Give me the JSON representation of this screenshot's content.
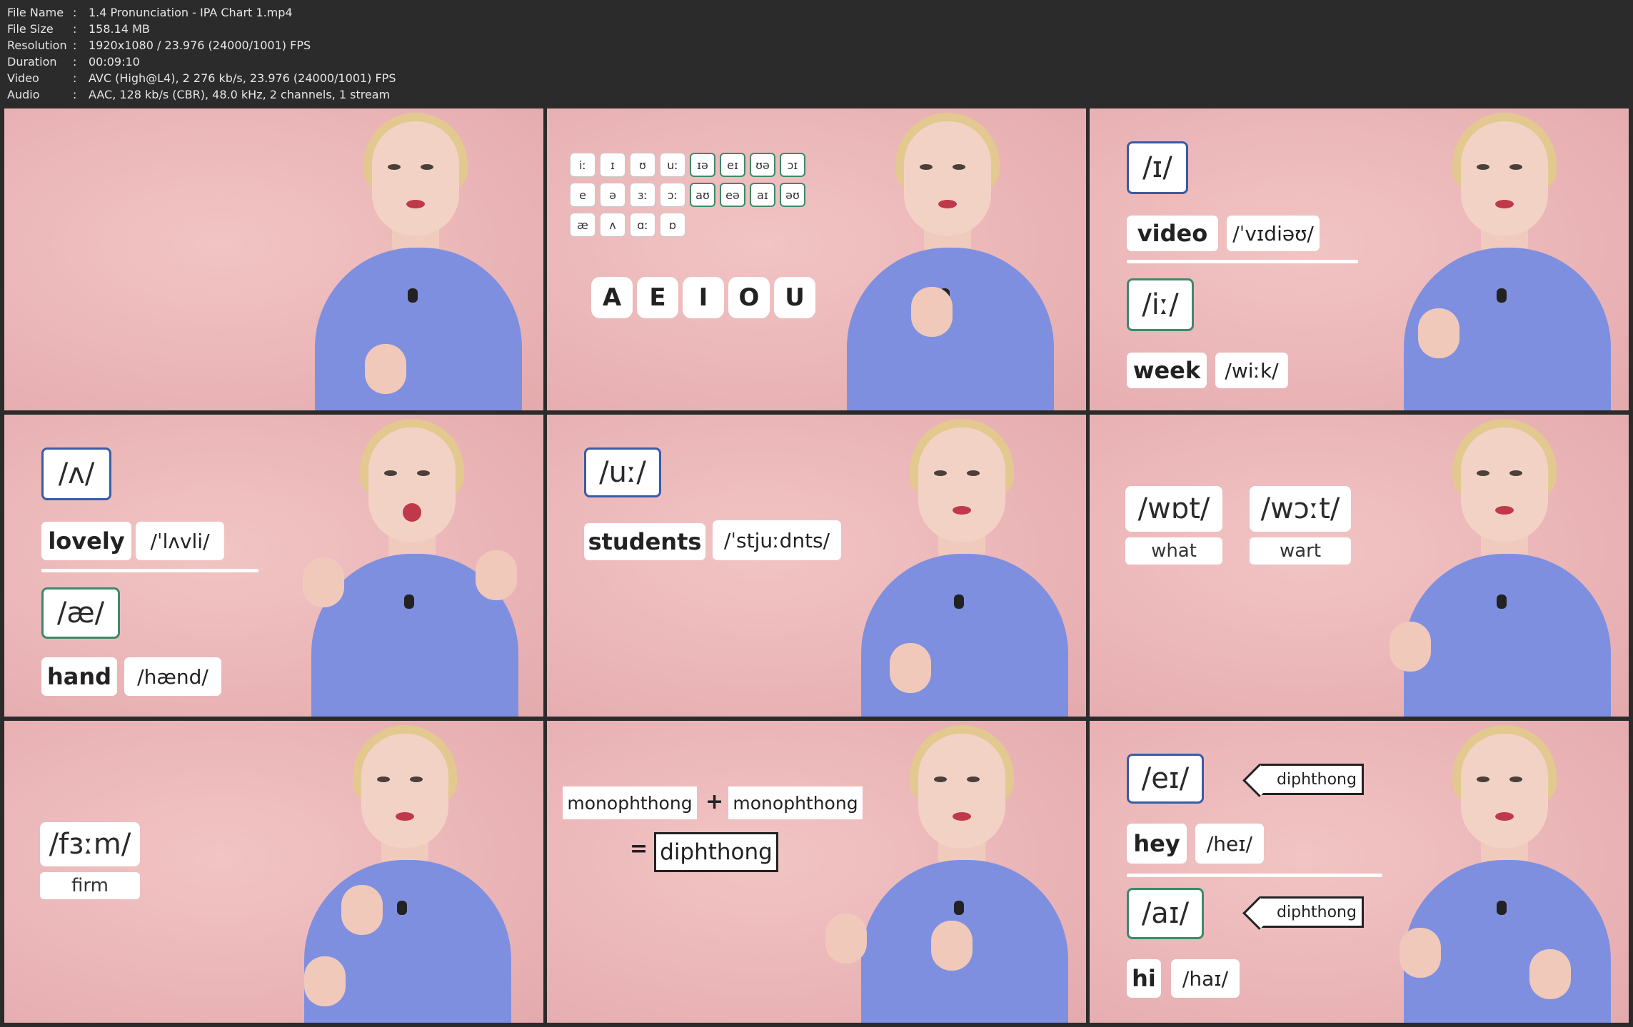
{
  "meta": [
    {
      "key": "File Name",
      "sep": ":",
      "value": "1.4 Pronunciation - IPA Chart 1.mp4"
    },
    {
      "key": "File Size",
      "sep": ":",
      "value": "158.14 MB"
    },
    {
      "key": "Resolution",
      "sep": ":",
      "value": "1920x1080 / 23.976 (24000/1001) FPS"
    },
    {
      "key": "Duration",
      "sep": ":",
      "value": "00:09:10"
    },
    {
      "key": "Video",
      "sep": ":",
      "value": "AVC (High@L4), 2 276 kb/s, 23.976 (24000/1001) FPS"
    },
    {
      "key": "Audio",
      "sep": ":",
      "value": "AAC, 128 kb/s (CBR), 48.0 kHz, 2 channels, 1 stream"
    }
  ],
  "tile2": {
    "chips": [
      "iː",
      "ɪ",
      "ʊ",
      "uː",
      "ɪə",
      "eɪ",
      "ʊə",
      "ɔɪ",
      "e",
      "ə",
      "ɜː",
      "ɔː",
      "aʊ",
      "eə",
      "aɪ",
      "əʊ",
      "æ",
      "ʌ",
      "ɑː",
      "ɒ"
    ],
    "vowels": [
      "A",
      "E",
      "I",
      "O",
      "U"
    ]
  },
  "tile3": {
    "ipa1": "/ɪ/",
    "word1": "video",
    "trans1": "/ˈvɪdiəʊ/",
    "ipa2": "/iː/",
    "word2": "week",
    "trans2": "/wiːk/"
  },
  "tile4": {
    "ipa1": "/ʌ/",
    "word1": "lovely",
    "trans1": "/ˈlʌvli/",
    "ipa2": "/æ/",
    "word2": "hand",
    "trans2": "/hænd/"
  },
  "tile5": {
    "ipa1": "/uː/",
    "word1": "students",
    "trans1": "/ˈstjuːdnts/"
  },
  "tile6": {
    "ipa1": "/wɒt/",
    "word1": "what",
    "ipa2": "/wɔːt/",
    "word2": "wart"
  },
  "tile7": {
    "ipa1": "/fɜːm/",
    "word1": "firm"
  },
  "tile8": {
    "mono1": "monophthong",
    "plus": "+",
    "mono2": "monophthong",
    "eq": "=",
    "result": "diphthong"
  },
  "tile9": {
    "ipa1": "/eɪ/",
    "tag1": "diphthong",
    "word1": "hey",
    "trans1": "/heɪ/",
    "ipa2": "/aɪ/",
    "tag2": "diphthong",
    "word2": "hi",
    "trans2": "/haɪ/"
  },
  "colors": {
    "background": "#ebb6b8",
    "shirt": "#7f8fe0",
    "ipa_blue": "#3a5ba5",
    "ipa_green": "#3d8a6a"
  }
}
